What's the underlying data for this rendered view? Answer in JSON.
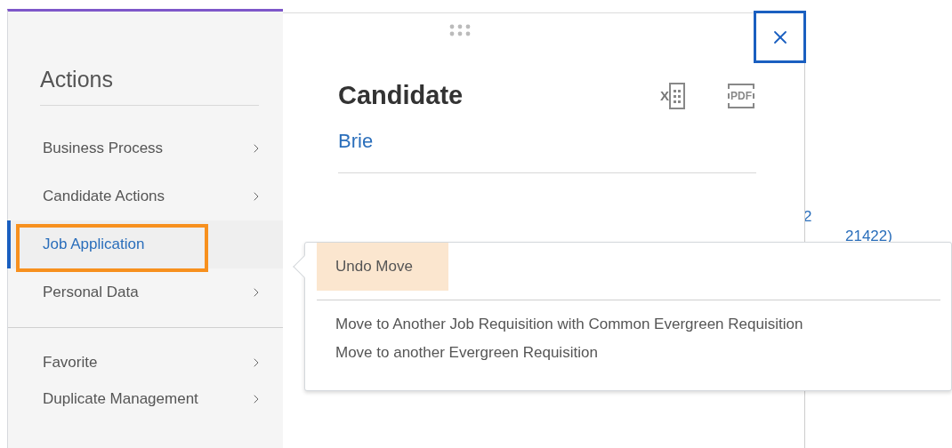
{
  "left_menu": {
    "title": "Actions",
    "groups": [
      [
        {
          "label": "Business Process",
          "chevron": true,
          "selected": false,
          "highlighted": false
        },
        {
          "label": "Candidate Actions",
          "chevron": true,
          "selected": false,
          "highlighted": false
        },
        {
          "label": "Job Application",
          "chevron": false,
          "selected": true,
          "highlighted": true
        },
        {
          "label": "Personal Data",
          "chevron": true,
          "selected": false,
          "highlighted": false
        }
      ],
      [
        {
          "label": "Favorite",
          "chevron": true,
          "selected": false,
          "highlighted": false
        },
        {
          "label": "Duplicate Management",
          "chevron": true,
          "selected": false,
          "highlighted": false
        }
      ]
    ]
  },
  "card": {
    "title": "Candidate",
    "name_link": "Brie",
    "excel_label": "X",
    "pdf_label": "PDF"
  },
  "submenu": {
    "groups": [
      [
        {
          "label": "Undo Move",
          "highlighted": true
        }
      ],
      [
        {
          "label": "Move to Another Job Requisition with Common Evergreen Requisition",
          "highlighted": false
        },
        {
          "label": "Move to another Evergreen Requisition",
          "highlighted": false
        }
      ]
    ]
  },
  "background_fragments": [
    "2",
    "21422)"
  ]
}
